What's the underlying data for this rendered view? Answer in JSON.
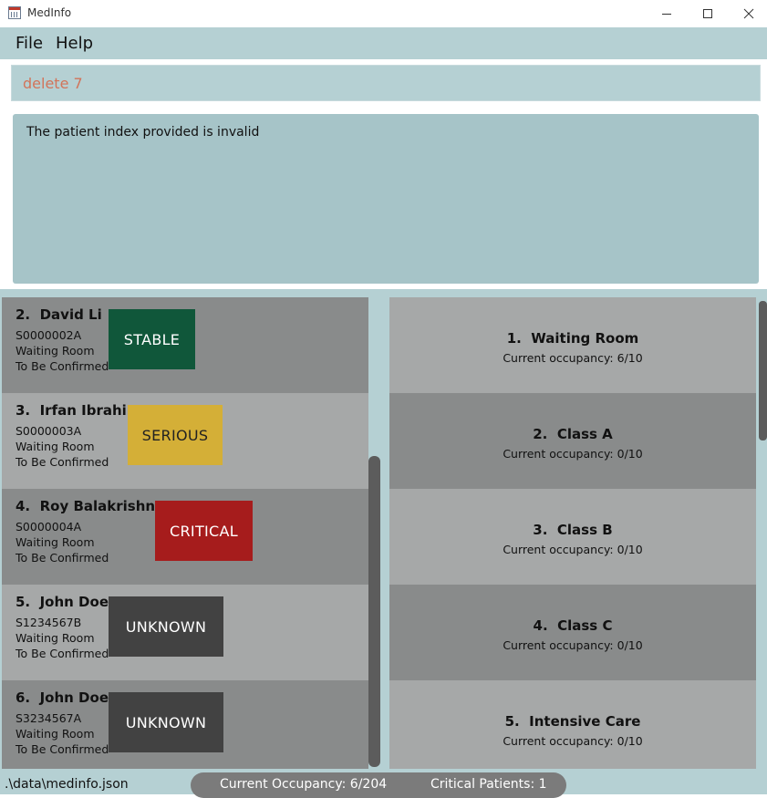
{
  "window": {
    "title": "MedInfo",
    "icon": "medinfo-app-icon",
    "controls": {
      "minimize": "—",
      "maximize": "☐",
      "close": "✕"
    }
  },
  "menu": {
    "file": "File",
    "help": "Help"
  },
  "command": {
    "value": "delete 7",
    "color": "#d2745a"
  },
  "result": {
    "message": "The patient index provided is invalid"
  },
  "patients": [
    {
      "index": "2.",
      "name": "David Li",
      "nric": "S0000002A",
      "ward": "Waiting Room",
      "status": "To Be Confirmed",
      "triage": "STABLE",
      "triage_color": "#10573a",
      "triage_text_color": "#ffffff"
    },
    {
      "index": "3.",
      "name": "Irfan Ibrahim",
      "nric": "S0000003A",
      "ward": "Waiting Room",
      "status": "To Be Confirmed",
      "triage": "SERIOUS",
      "triage_color": "#d4af37",
      "triage_text_color": "#222222"
    },
    {
      "index": "4.",
      "name": "Roy Balakrishnan",
      "nric": "S0000004A",
      "ward": "Waiting Room",
      "status": "To Be Confirmed",
      "triage": "CRITICAL",
      "triage_color": "#a61c1c",
      "triage_text_color": "#ffffff"
    },
    {
      "index": "5.",
      "name": "John Doe",
      "nric": "S1234567B",
      "ward": "Waiting Room",
      "status": "To Be Confirmed",
      "triage": "UNKNOWN",
      "triage_color": "#424242",
      "triage_text_color": "#ffffff"
    },
    {
      "index": "6.",
      "name": "John Doe",
      "nric": "S3234567A",
      "ward": "Waiting Room",
      "status": "To Be Confirmed",
      "triage": "UNKNOWN",
      "triage_color": "#424242",
      "triage_text_color": "#ffffff"
    }
  ],
  "wards": [
    {
      "index": "1.",
      "name": "Waiting Room",
      "occupancy": "Current occupancy: 6/10"
    },
    {
      "index": "2.",
      "name": "Class A",
      "occupancy": "Current occupancy: 0/10"
    },
    {
      "index": "3.",
      "name": "Class B",
      "occupancy": "Current occupancy: 0/10"
    },
    {
      "index": "4.",
      "name": "Class C",
      "occupancy": "Current occupancy: 0/10"
    },
    {
      "index": "5.",
      "name": "Intensive Care",
      "occupancy": "Current occupancy: 0/10"
    }
  ],
  "status_bar": {
    "path": ".\\data\\medinfo.json",
    "occupancy": "Current Occupancy: 6/204",
    "critical": "Critical Patients: 1"
  },
  "colors": {
    "accent": "#b5d0d3",
    "result_bg": "#a6c4c8",
    "card_dark": "#898b8b",
    "card_light": "#a6a8a8",
    "scrollbar": "#5c5c5c",
    "status_pill": "#7b7b7b"
  }
}
